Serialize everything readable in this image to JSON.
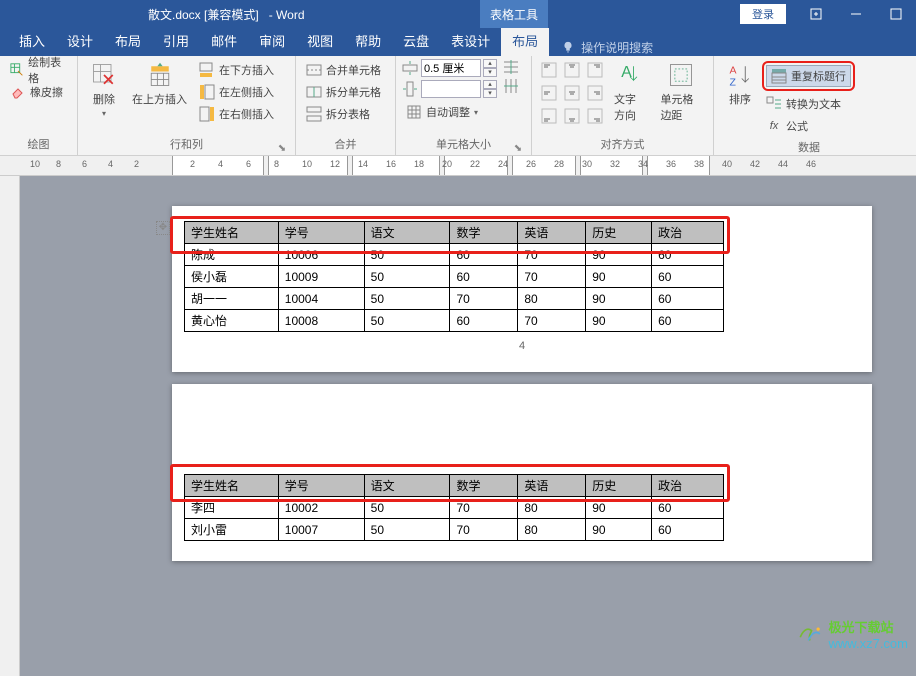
{
  "title": {
    "file": "散文.docx [兼容模式]",
    "app": "- Word",
    "tools": "表格工具",
    "login": "登录"
  },
  "menu": [
    "插入",
    "设计",
    "布局",
    "引用",
    "邮件",
    "审阅",
    "视图",
    "帮助",
    "云盘",
    "表设计",
    "布局"
  ],
  "tellme": "操作说明搜索",
  "ribbon": {
    "draw": {
      "label": "绘图",
      "drawtable": "绘制表格",
      "eraser": "橡皮擦"
    },
    "delete": {
      "label": "行和列",
      "delete": "删除",
      "above": "在上方插入",
      "below": "在下方插入",
      "left": "在左侧插入",
      "right": "在右侧插入"
    },
    "merge": {
      "label": "合并",
      "mergecells": "合并单元格",
      "splitcells": "拆分单元格",
      "splittable": "拆分表格"
    },
    "size": {
      "label": "单元格大小",
      "height": "0.5 厘米",
      "autofit": "自动调整"
    },
    "align": {
      "label": "对齐方式",
      "textdir": "文字方向",
      "margins": "单元格边距"
    },
    "data": {
      "label": "数据",
      "sort": "排序",
      "repeatheader": "重复标题行",
      "converttext": "转换为文本",
      "formula": "公式"
    }
  },
  "ruler": {
    "left": [
      "10",
      "8",
      "6",
      "4",
      "2"
    ],
    "right": [
      "2",
      "4",
      "6",
      "8",
      "10",
      "12",
      "14",
      "16",
      "18",
      "20",
      "22",
      "24",
      "26",
      "28",
      "30",
      "32",
      "34",
      "36",
      "38",
      "40",
      "42",
      "44",
      "46"
    ]
  },
  "table": {
    "headers": [
      "学生姓名",
      "学号",
      "语文",
      "数学",
      "英语",
      "历史",
      "政治"
    ],
    "page1rows": [
      [
        "陈成",
        "10006",
        "50",
        "60",
        "70",
        "90",
        "60"
      ],
      [
        "侯小磊",
        "10009",
        "50",
        "60",
        "70",
        "90",
        "60"
      ],
      [
        "胡一一",
        "10004",
        "50",
        "70",
        "80",
        "90",
        "60"
      ],
      [
        "黄心怡",
        "10008",
        "50",
        "60",
        "70",
        "90",
        "60"
      ]
    ],
    "pagenum": "4",
    "page2rows": [
      [
        "李四",
        "10002",
        "50",
        "70",
        "80",
        "90",
        "60"
      ],
      [
        "刘小雷",
        "10007",
        "50",
        "70",
        "80",
        "90",
        "60"
      ]
    ]
  },
  "watermark": {
    "line1": "极光下载站",
    "line2": "www.xz7.com"
  }
}
